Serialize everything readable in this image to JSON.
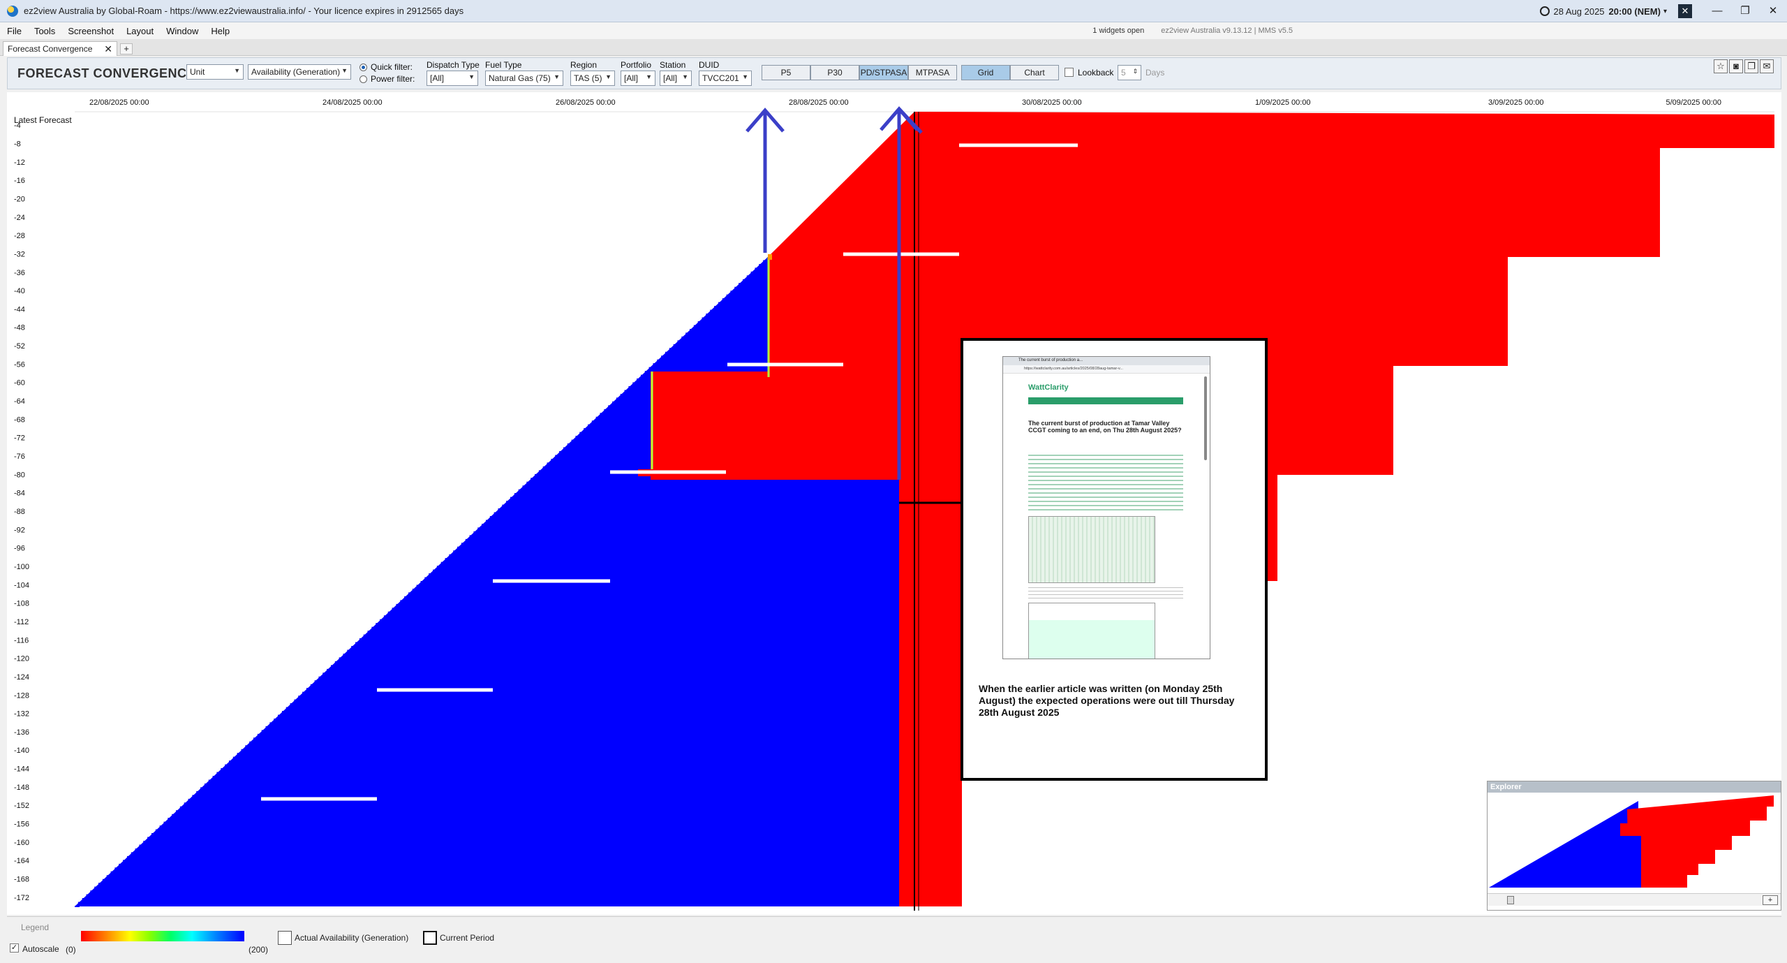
{
  "titlebar": {
    "app_title": "ez2view Australia by Global-Roam - https://www.ez2viewaustralia.info/ - Your licence expires in 2912565 days",
    "date": "28 Aug 2025",
    "time": "20:00 (NEM)",
    "caret": "▾",
    "mute_icon": "speaker-mute",
    "minimize": "—",
    "maximize": "❐",
    "close": "✕"
  },
  "menu": {
    "items": [
      "File",
      "Tools",
      "Screenshot",
      "Layout",
      "Window",
      "Help"
    ],
    "widgets_open": "1 widgets open",
    "version": "ez2view Australia v9.13.12 | MMS v5.5"
  },
  "tabs": {
    "active_label": "Forecast Convergence",
    "close_glyph": "✕",
    "add_glyph": "+"
  },
  "toolbar": {
    "title": "FORECAST CONVERGENCE",
    "unit_select": "Unit",
    "measure_select": "Availability (Generation)",
    "quick_filter_label": "Quick filter:",
    "power_filter_label": "Power filter:",
    "dispatch_type_label": "Dispatch Type",
    "dispatch_type_value": "[All]",
    "fuel_type_label": "Fuel Type",
    "fuel_type_value": "Natural Gas (75)",
    "region_label": "Region",
    "region_value": "TAS (5)",
    "portfolio_label": "Portfolio",
    "portfolio_value": "[All]",
    "station_label": "Station",
    "station_value": "[All]",
    "duid_label": "DUID",
    "duid_value": "TVCC201",
    "buttons": [
      "P5",
      "P30",
      "PD/STPASA",
      "MTPASA"
    ],
    "selected_button": "PD/STPASA",
    "grid_label": "Grid",
    "chart_label": "Chart",
    "lookback_label": "Lookback",
    "lookback_value": "5",
    "days_label": "Days",
    "icons": [
      "star-icon",
      "camera-icon",
      "copy-icon",
      "comment-icon"
    ]
  },
  "chart_data": {
    "type": "heatmap",
    "y_axis_title": "Latest Forecast",
    "x_tick_labels": [
      "22/08/2025 00:00",
      "24/08/2025 00:00",
      "26/08/2025 00:00",
      "28/08/2025 00:00",
      "30/08/2025 00:00",
      "1/09/2025 00:00",
      "3/09/2025 00:00",
      "5/09/2025 00:00"
    ],
    "y_tick_labels": [
      "-4",
      "-8",
      "-12",
      "-16",
      "-20",
      "-24",
      "-28",
      "-32",
      "-36",
      "-40",
      "-44",
      "-48",
      "-52",
      "-56",
      "-60",
      "-64",
      "-68",
      "-72",
      "-76",
      "-80",
      "-84",
      "-88",
      "-92",
      "-96",
      "-100",
      "-104",
      "-108",
      "-112",
      "-116",
      "-120",
      "-124",
      "-128",
      "-132",
      "-136",
      "-140",
      "-144",
      "-148",
      "-152",
      "-156",
      "-160",
      "-164",
      "-168",
      "-172"
    ],
    "color_scale": {
      "min": 0,
      "max": 200,
      "low_color": "#ff0000",
      "high_color": "#0000ff"
    },
    "annotation_colors": {
      "arrow": "#3b3fc8",
      "marker": "#ffffff",
      "cell_high": "#0000ff",
      "cell_low": "#ff0000"
    }
  },
  "article": {
    "window_title": "The current burst of production a...",
    "url": "https://wattclarity.com.au/articles/2025/08/28aug-tamar-v...",
    "site_name": "WattClarity",
    "headline": "The current burst of production at Tamar Valley CCGT coming to an end, on Thu 28th August 2025?",
    "caption": "When the earlier article was written (on Monday 25th August) the expected operations were out till Thursday 28th August 2025"
  },
  "explorer": {
    "title": "Explorer",
    "plus": "+"
  },
  "legend": {
    "title": "Legend",
    "min": "(0)",
    "max": "(200)",
    "actual_label": "Actual Availability (Generation)",
    "current_label": "Current Period",
    "autoscale_label": "Autoscale",
    "check_glyph": "✓"
  }
}
